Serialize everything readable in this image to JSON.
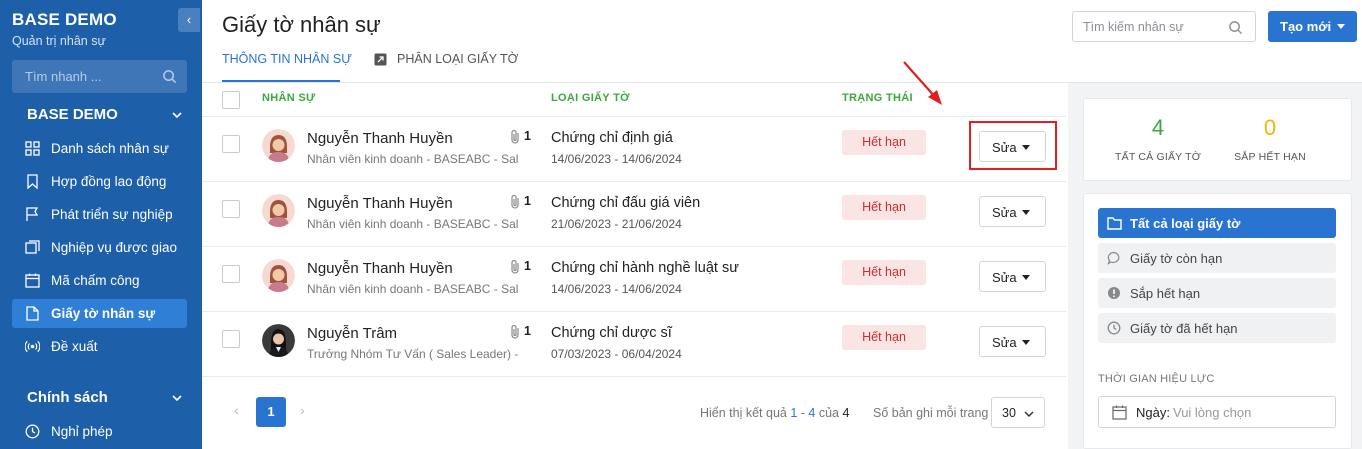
{
  "sidebar": {
    "brand": "BASE DEMO",
    "brand_sub": "Quản trị nhân sự",
    "collapse_icon": "‹",
    "search_placeholder": "Tìm nhanh ...",
    "group1_title": "BASE DEMO",
    "items": [
      {
        "label": "Danh sách nhân sự",
        "icon": "grid-icon"
      },
      {
        "label": "Hợp đồng lao động",
        "icon": "bookmark-icon"
      },
      {
        "label": "Phát triển sự nghiệp",
        "icon": "flag-icon"
      },
      {
        "label": "Nghiệp vụ được giao",
        "icon": "layers-icon"
      },
      {
        "label": "Mã chấm công",
        "icon": "calendar-icon"
      },
      {
        "label": "Giấy tờ nhân sự",
        "icon": "document-icon"
      },
      {
        "label": "Đề xuất",
        "icon": "broadcast-icon"
      }
    ],
    "group2_title": "Chính sách",
    "group2_items": [
      {
        "label": "Nghỉ phép",
        "icon": "clock-icon"
      }
    ]
  },
  "header": {
    "title": "Giấy tờ nhân sự",
    "search_placeholder": "Tìm kiếm nhân sự",
    "create_label": "Tạo mới",
    "tabs": [
      {
        "label": "THÔNG TIN NHÂN SỰ",
        "active": true
      },
      {
        "label": "PHÂN LOẠI GIẤY TỜ",
        "active": false
      }
    ]
  },
  "table": {
    "columns": [
      "NHÂN SỰ",
      "LOẠI GIẤY TỜ",
      "TRẠNG THÁI"
    ],
    "rows": [
      {
        "name": "Nguyễn Thanh Huyền",
        "sub": "Nhân viên kinh doanh - BASEABC - Sal...",
        "attachments": "1",
        "doc_type": "Chứng chỉ định giá",
        "dates": "14/06/2023 - 14/06/2024",
        "status": "Hết hạn",
        "action": "Sửa"
      },
      {
        "name": "Nguyễn Thanh Huyền",
        "sub": "Nhân viên kinh doanh - BASEABC - Sal...",
        "attachments": "1",
        "doc_type": "Chứng chỉ đấu giá viên",
        "dates": "21/06/2023 - 21/06/2024",
        "status": "Hết hạn",
        "action": "Sửa"
      },
      {
        "name": "Nguyễn Thanh Huyền",
        "sub": "Nhân viên kinh doanh - BASEABC - Sal...",
        "attachments": "1",
        "doc_type": "Chứng chỉ hành nghề luật sư",
        "dates": "14/06/2023 - 14/06/2024",
        "status": "Hết hạn",
        "action": "Sửa"
      },
      {
        "name": "Nguyễn Trâm",
        "sub": "Trưởng Nhóm Tư Vấn ( Sales Leader) -...",
        "attachments": "1",
        "doc_type": "Chứng chỉ dược sĩ",
        "dates": "07/03/2023 - 06/04/2024",
        "status": "Hết hạn",
        "action": "Sửa"
      }
    ]
  },
  "pagination": {
    "prev": "‹",
    "next": "›",
    "current_page": "1",
    "info_prefix": "Hiển thị kết quả ",
    "range_start": "1",
    "range_sep": " - ",
    "range_end": "4",
    "of_text": " của ",
    "total": "4",
    "page_size_label": "Số bản ghi mỗi trang",
    "page_size": "30"
  },
  "stats": {
    "all_docs_count": "4",
    "all_docs_label": "TẤT CẢ GIẤY TỜ",
    "expiring_count": "0",
    "expiring_label": "SẮP HẾT HẠN",
    "colors": {
      "all": "#3aa83a",
      "expiring": "#f0b800"
    }
  },
  "filters": {
    "items": [
      {
        "label": "Tất cả loại giấy tờ",
        "active": true,
        "icon": "folder-icon"
      },
      {
        "label": "Giấy tờ còn hạn",
        "active": false,
        "icon": "speech-bubble-icon"
      },
      {
        "label": "Sắp hết hạn",
        "active": false,
        "icon": "exclamation-icon"
      },
      {
        "label": "Giấy tờ đã hết hạn",
        "active": false,
        "icon": "clock-icon"
      }
    ],
    "validity_label": "THỜI GIAN HIỆU LỰC",
    "date_label": "Ngày:",
    "date_placeholder": "Vui lòng chọn"
  },
  "colors": {
    "sidebar": "#1d5fa8",
    "accent": "#2a74d1",
    "header_green": "#3aa83a",
    "expired_bg": "#fbe4e4",
    "expired_text": "#cc2d2d",
    "highlight": "#e02020"
  }
}
